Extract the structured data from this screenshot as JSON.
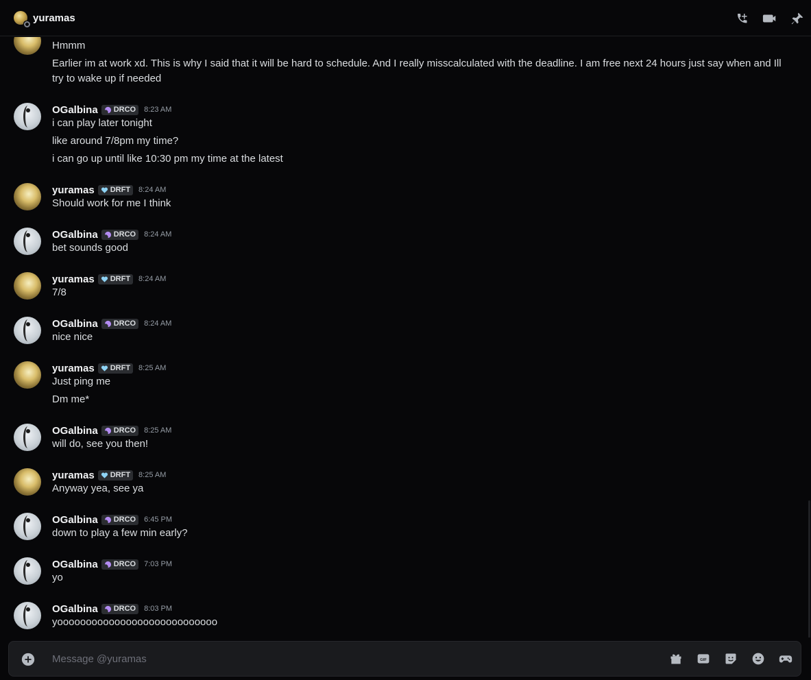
{
  "header": {
    "title": "yuramas",
    "actions": [
      "voice-call-icon",
      "video-call-icon",
      "pin-icon"
    ]
  },
  "colors": {
    "background": "#070709",
    "text": "#dbdee1",
    "username": "#f2f3f5",
    "timestamp": "#949ba4",
    "drft_tag_icon": "#8ed3f5",
    "drco_tag_icon": "#b38cf2",
    "composer_bg": "#1a1b1e"
  },
  "messages": [
    {
      "author": "",
      "tag": "",
      "time": "",
      "lines": [
        "Hmmm",
        "Earlier im at work xd. This is why I said that it will be hard to schedule.  And I really misscalculated with the deadline. I am free next 24 hours just say when and Ill try to wake up if needed"
      ]
    },
    {
      "author": "OGalbina",
      "tag": "DRCO",
      "time": "8:23 AM",
      "lines": [
        "i can play later tonight",
        "like around 7/8pm my time?",
        "i can go up until like 10:30 pm my time at the latest"
      ]
    },
    {
      "author": "yuramas",
      "tag": "DRFT",
      "time": "8:24 AM",
      "lines": [
        "Should work for me I think"
      ]
    },
    {
      "author": "OGalbina",
      "tag": "DRCO",
      "time": "8:24 AM",
      "lines": [
        "bet sounds good"
      ]
    },
    {
      "author": "yuramas",
      "tag": "DRFT",
      "time": "8:24 AM",
      "lines": [
        "7/8"
      ]
    },
    {
      "author": "OGalbina",
      "tag": "DRCO",
      "time": "8:24 AM",
      "lines": [
        "nice nice"
      ]
    },
    {
      "author": "yuramas",
      "tag": "DRFT",
      "time": "8:25 AM",
      "lines": [
        "Just ping me",
        "Dm me*"
      ]
    },
    {
      "author": "OGalbina",
      "tag": "DRCO",
      "time": "8:25 AM",
      "lines": [
        "will do, see you then!"
      ]
    },
    {
      "author": "yuramas",
      "tag": "DRFT",
      "time": "8:25 AM",
      "lines": [
        "Anyway yea, see ya"
      ]
    },
    {
      "author": "OGalbina",
      "tag": "DRCO",
      "time": "6:45 PM",
      "lines": [
        "down to play a few min early?"
      ]
    },
    {
      "author": "OGalbina",
      "tag": "DRCO",
      "time": "7:03 PM",
      "lines": [
        "yo"
      ]
    },
    {
      "author": "OGalbina",
      "tag": "DRCO",
      "time": "8:03 PM",
      "lines": [
        "yoooooooooooooooooooooooooooo"
      ]
    }
  ],
  "composer": {
    "placeholder": "Message @yuramas",
    "value": "",
    "tools": [
      "gift-icon",
      "gif-icon",
      "sticker-icon",
      "emoji-icon",
      "apps-icon"
    ]
  }
}
